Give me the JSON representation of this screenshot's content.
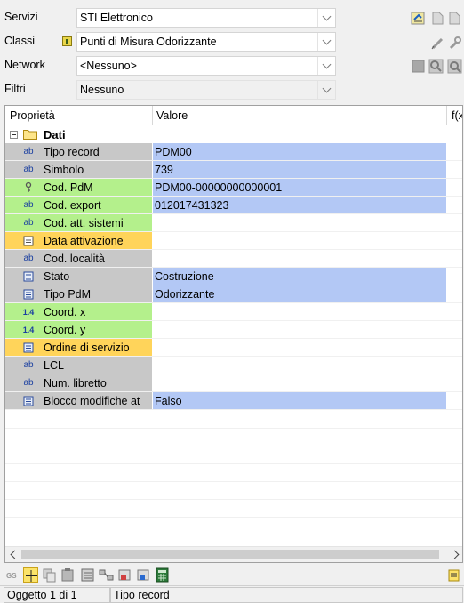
{
  "filters": [
    {
      "label": "Servizi",
      "value": "STI Elettronico",
      "icon": null,
      "style": "white"
    },
    {
      "label": "Classi",
      "value": "Punti di Misura Odorizzante",
      "icon": "class-icon",
      "style": "white"
    },
    {
      "label": "Network",
      "value": "<Nessuno>",
      "icon": null,
      "style": "white"
    },
    {
      "label": "Filtri",
      "value": "Nessuno",
      "icon": null,
      "style": "plain"
    }
  ],
  "grid": {
    "headers": {
      "property": "Proprietà",
      "value": "Valore",
      "function": "f(x"
    },
    "category": {
      "name": "Dati"
    },
    "rows": [
      {
        "name": "Tipo record",
        "value": "PDM00",
        "icon": "ab",
        "color": "#c8c8c8",
        "vcolor": "#b3c8f5"
      },
      {
        "name": "Simbolo",
        "value": "739",
        "icon": "ab",
        "color": "#c8c8c8",
        "vcolor": "#b3c8f5"
      },
      {
        "name": "Cod. PdM",
        "value": "PDM00-00000000000001",
        "icon": "key",
        "color": "#b4f08c",
        "vcolor": "#b3c8f5"
      },
      {
        "name": "Cod. export",
        "value": "012017431323",
        "icon": "ab",
        "color": "#b4f08c",
        "vcolor": "#b3c8f5"
      },
      {
        "name": "Cod. att. sistemi",
        "value": "",
        "icon": "ab",
        "color": "#b4f08c",
        "vcolor": "#ffffff"
      },
      {
        "name": "Data attivazione",
        "value": "",
        "icon": "calendar",
        "color": "#ffd45a",
        "vcolor": "#ffffff"
      },
      {
        "name": "Cod. località",
        "value": "",
        "icon": "ab",
        "color": "#c8c8c8",
        "vcolor": "#ffffff"
      },
      {
        "name": "Stato",
        "value": "Costruzione",
        "icon": "list",
        "color": "#c8c8c8",
        "vcolor": "#b3c8f5"
      },
      {
        "name": "Tipo PdM",
        "value": "Odorizzante",
        "icon": "list",
        "color": "#c8c8c8",
        "vcolor": "#b3c8f5"
      },
      {
        "name": "Coord. x",
        "value": "",
        "icon": "1.4",
        "color": "#b4f08c",
        "vcolor": "#ffffff"
      },
      {
        "name": "Coord. y",
        "value": "",
        "icon": "1.4",
        "color": "#b4f08c",
        "vcolor": "#ffffff"
      },
      {
        "name": "Ordine di servizio",
        "value": "",
        "icon": "list",
        "color": "#ffd45a",
        "vcolor": "#ffffff"
      },
      {
        "name": "LCL",
        "value": "",
        "icon": "ab",
        "color": "#c8c8c8",
        "vcolor": "#ffffff"
      },
      {
        "name": "Num. libretto",
        "value": "",
        "icon": "ab",
        "color": "#c8c8c8",
        "vcolor": "#ffffff"
      },
      {
        "name": "Blocco modifiche at",
        "value": "Falso",
        "icon": "list",
        "color": "#c8c8c8",
        "vcolor": "#b3c8f5"
      }
    ]
  },
  "status": {
    "object": "Oggetto 1 di 1",
    "field": "Tipo record"
  }
}
